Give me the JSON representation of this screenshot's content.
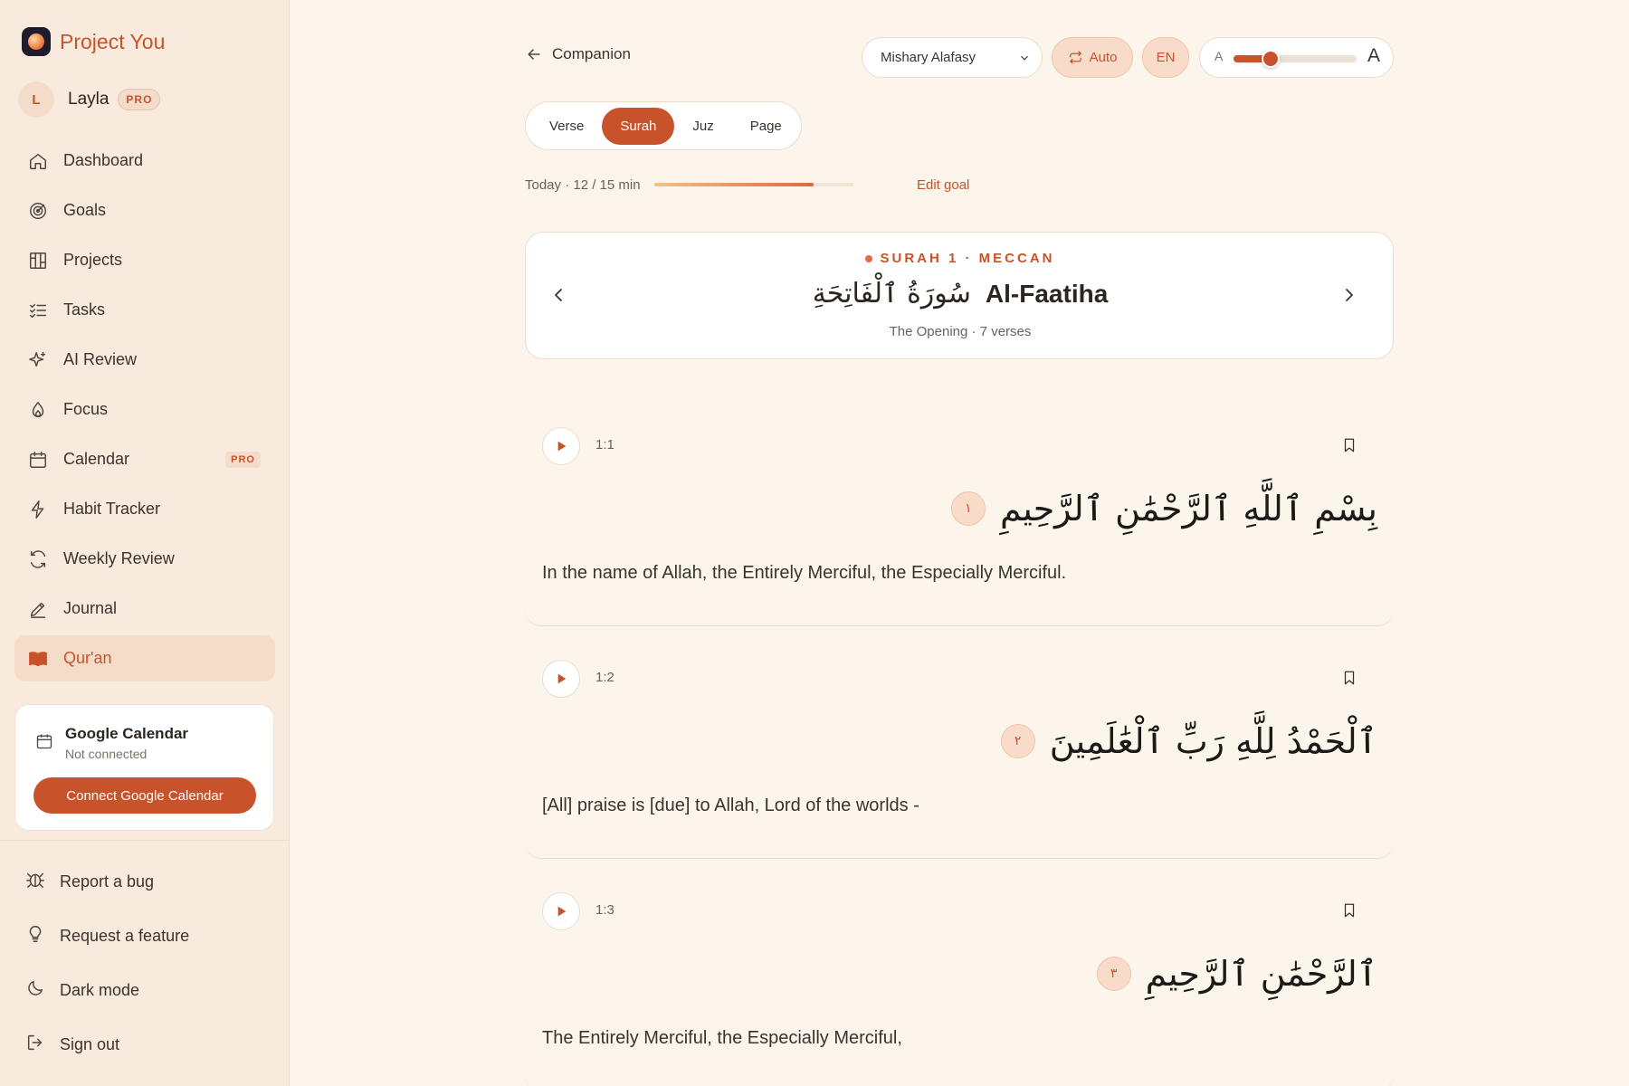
{
  "app": {
    "name": "Project You"
  },
  "user": {
    "initial": "L",
    "name": "Layla",
    "badge": "PRO"
  },
  "nav": [
    {
      "label": "Dashboard",
      "icon": "home-icon"
    },
    {
      "label": "Goals",
      "icon": "target-icon"
    },
    {
      "label": "Projects",
      "icon": "grid-icon"
    },
    {
      "label": "Tasks",
      "icon": "checklist-icon"
    },
    {
      "label": "AI Review",
      "icon": "sparkle-icon"
    },
    {
      "label": "Focus",
      "icon": "flame-icon"
    },
    {
      "label": "Calendar",
      "icon": "calendar-icon",
      "badge": "PRO"
    },
    {
      "label": "Habit Tracker",
      "icon": "bolt-icon"
    },
    {
      "label": "Weekly Review",
      "icon": "refresh-icon"
    },
    {
      "label": "Journal",
      "icon": "pen-icon"
    },
    {
      "label": "Qur'an",
      "icon": "book-icon",
      "active": true
    }
  ],
  "google_calendar": {
    "title": "Google Calendar",
    "status": "Not connected",
    "button": "Connect Google Calendar"
  },
  "bottom_nav": [
    {
      "label": "Report a bug",
      "icon": "bug-icon"
    },
    {
      "label": "Request a feature",
      "icon": "lightbulb-icon"
    },
    {
      "label": "Dark mode",
      "icon": "moon-icon"
    },
    {
      "label": "Sign out",
      "icon": "sign-out-icon"
    }
  ],
  "header": {
    "back_label": "Companion",
    "reciter": "Mishary Alafasy",
    "auto_label": "Auto",
    "language": "EN",
    "font_size": {
      "small_label": "A",
      "large_label": "A",
      "value_fraction": 0.3
    }
  },
  "modes": [
    {
      "label": "Verse"
    },
    {
      "label": "Surah",
      "active": true
    },
    {
      "label": "Juz"
    },
    {
      "label": "Page"
    }
  ],
  "goal": {
    "text": "Today · 12 / 15 min",
    "progress": 0.8,
    "edit_label": "Edit goal"
  },
  "surah": {
    "meta": "SURAH 1 · MECCAN",
    "arabic_name": "سُورَةُ ٱلْفَاتِحَةِ",
    "name": "Al-Faatiha",
    "subtitle": "The Opening · 7 verses"
  },
  "verses": [
    {
      "key": "1:1",
      "number": "١",
      "arabic": "بِسْمِ ٱللَّهِ ٱلرَّحْمَٰنِ ٱلرَّحِيمِ",
      "translation": "In the name of Allah, the Entirely Merciful, the Especially Merciful."
    },
    {
      "key": "1:2",
      "number": "٢",
      "arabic": "ٱلْحَمْدُ لِلَّهِ رَبِّ ٱلْعَٰلَمِينَ",
      "translation": "[All] praise is [due] to Allah, Lord of the worlds -"
    },
    {
      "key": "1:3",
      "number": "٣",
      "arabic": "ٱلرَّحْمَٰنِ ٱلرَّحِيمِ",
      "translation": "The Entirely Merciful, the Especially Merciful,"
    }
  ],
  "colors": {
    "accent": "#c8532b",
    "background": "#fcf5ec",
    "sidebar": "#f8ebdd"
  }
}
